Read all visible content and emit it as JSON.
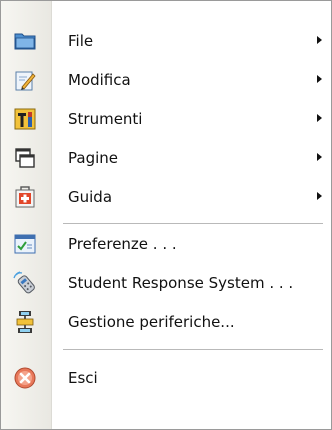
{
  "menu": {
    "items": [
      {
        "label": "File",
        "icon": "folder-icon",
        "submenu": true
      },
      {
        "label": "Modifica",
        "icon": "edit-document-icon",
        "submenu": true
      },
      {
        "label": "Strumenti",
        "icon": "tools-icon",
        "submenu": true
      },
      {
        "label": "Pagine",
        "icon": "pages-icon",
        "submenu": true
      },
      {
        "label": "Guida",
        "icon": "help-kit-icon",
        "submenu": true
      },
      {
        "label": "Preferenze . . .",
        "icon": "preferences-icon",
        "submenu": false
      },
      {
        "label": "Student Response System . . .",
        "icon": "response-remote-icon",
        "submenu": false
      },
      {
        "label": "Gestione periferiche...",
        "icon": "device-manager-icon",
        "submenu": false
      },
      {
        "label": "Esci",
        "icon": "exit-icon",
        "submenu": false
      }
    ]
  }
}
